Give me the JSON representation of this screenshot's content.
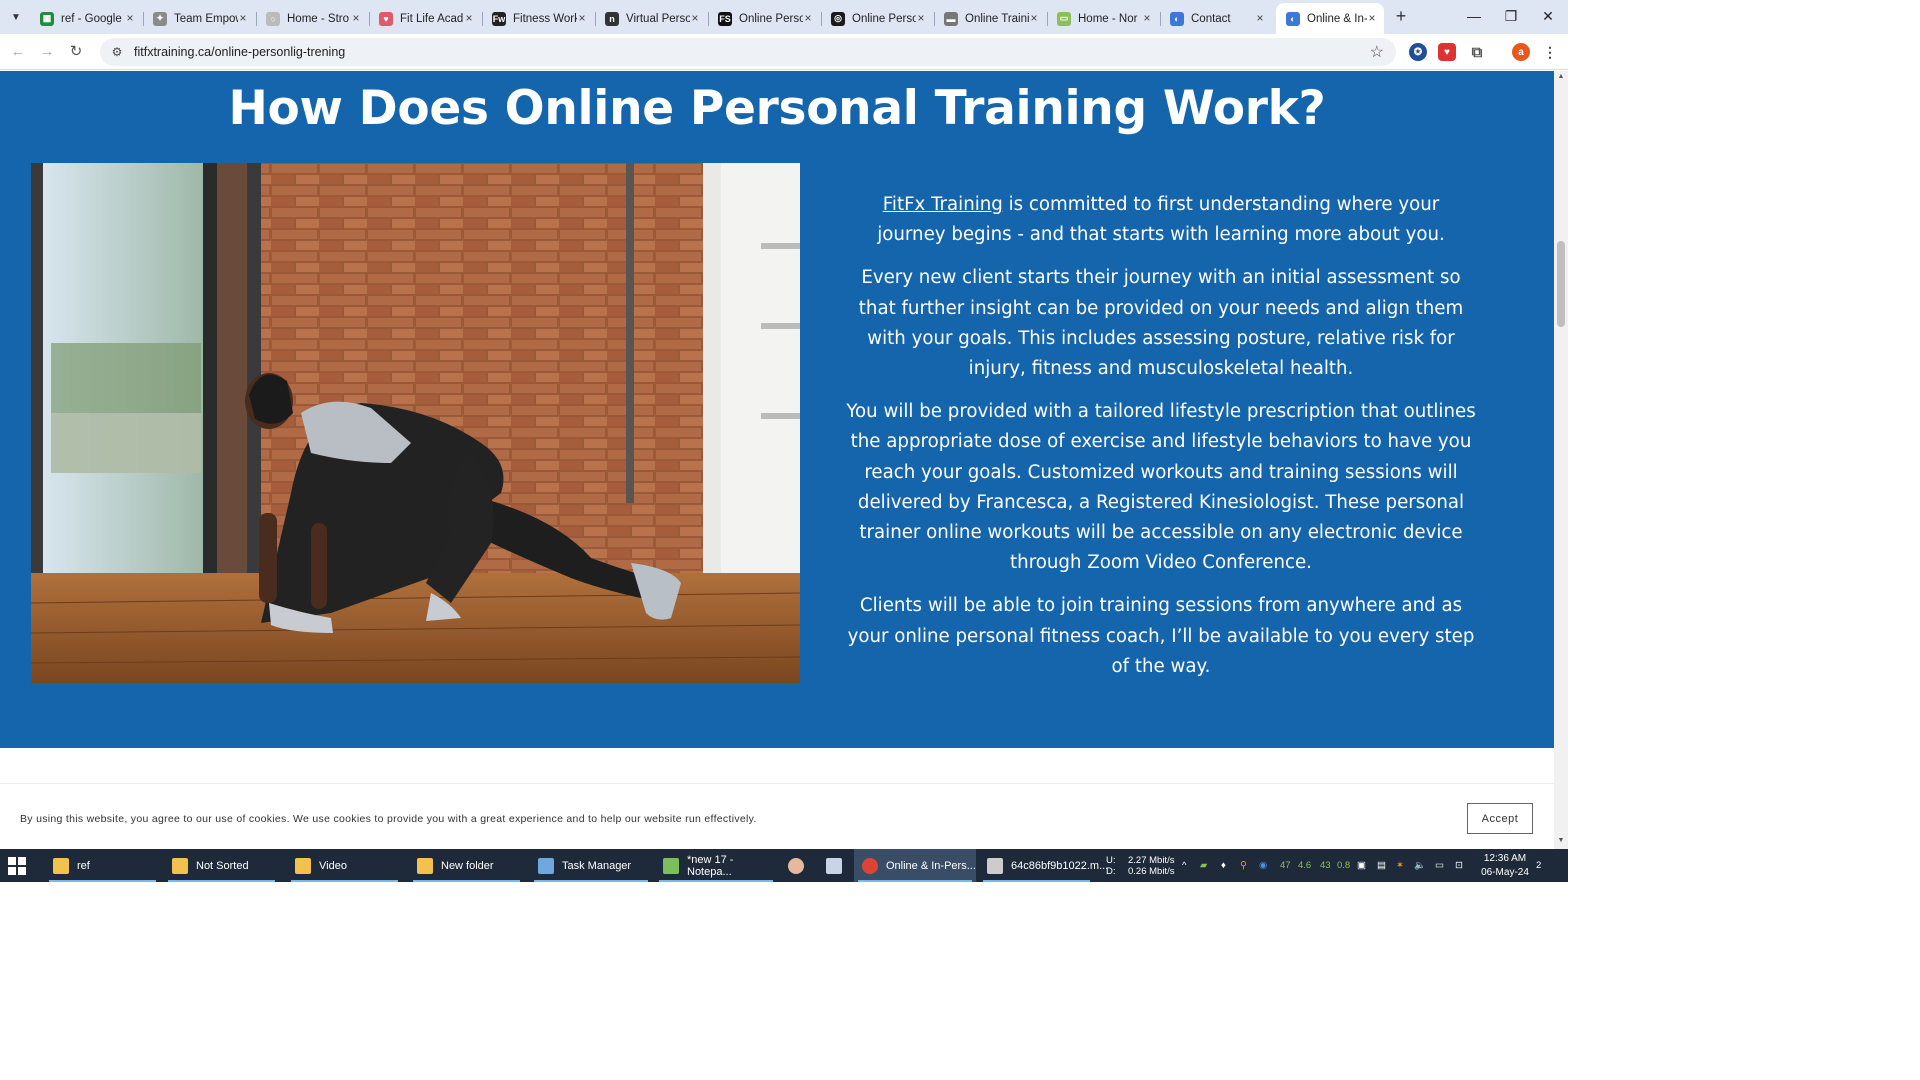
{
  "browser": {
    "tabs": [
      {
        "title": "ref - Google",
        "favicon_color": "#1e8e3e",
        "favicon_glyph": "▦"
      },
      {
        "title": "Team Empow",
        "favicon_color": "#8a8a8a",
        "favicon_glyph": "✦"
      },
      {
        "title": "Home - Stro",
        "favicon_color": "#bbbbbb",
        "favicon_glyph": "○"
      },
      {
        "title": "Fit Life Acad",
        "favicon_color": "#e05a6a",
        "favicon_glyph": "♥"
      },
      {
        "title": "Fitness Work",
        "favicon_color": "#222222",
        "favicon_glyph": "Fw"
      },
      {
        "title": "Virtual Perso",
        "favicon_color": "#333333",
        "favicon_glyph": "n"
      },
      {
        "title": "Online Perso",
        "favicon_color": "#111111",
        "favicon_glyph": "FS"
      },
      {
        "title": "Online Perso",
        "favicon_color": "#1a1a1a",
        "favicon_glyph": "◎"
      },
      {
        "title": "Online Traini",
        "favicon_color": "#777777",
        "favicon_glyph": "▬"
      },
      {
        "title": "Home - Nor",
        "favicon_color": "#8bbf5a",
        "favicon_glyph": "▭"
      },
      {
        "title": "Contact",
        "favicon_color": "#3c78d8",
        "favicon_glyph": "◐"
      },
      {
        "title": "Online & In-",
        "favicon_color": "#3c78d8",
        "favicon_glyph": "◐"
      }
    ],
    "url": "fitfxtraining.ca/online-personlig-trening",
    "profile_initial": "a"
  },
  "page": {
    "heading": "How Does Online Personal Training Work?",
    "p1_link": "FitFx Training",
    "p1_rest": " is committed to first understanding where your journey begins - and that starts with learning more about you.",
    "p2": "Every new client starts their journey with an initial assessment so that further insight can be provided on your needs and align them with your goals. This includes assessing posture, relative risk for injury, fitness and musculoskeletal health.",
    "p3": "You will be provided with a tailored lifestyle prescription that outlines the appropriate dose of exercise and lifestyle behaviors to have you reach your goals. Customized workouts and training sessions will delivered by Francesca, a Registered Kinesiologist. These personal trainer online workouts will be accessible on any electronic device through Zoom Video Conference.",
    "p4": "Clients will be able to join training sessions from anywhere and as your online personal fitness coach, I’ll be available to you every step of the way."
  },
  "cookie": {
    "text": "By using this website, you agree to our use of cookies. We use cookies to provide you with a great experience and to help our website run effectively.",
    "accept": "Accept"
  },
  "taskbar": {
    "items": [
      {
        "label": "ref",
        "icon_color": "#f2c14e"
      },
      {
        "label": "Not Sorted",
        "icon_color": "#f2c14e"
      },
      {
        "label": "Video",
        "icon_color": "#f2c14e"
      },
      {
        "label": "New folder",
        "icon_color": "#f2c14e"
      },
      {
        "label": "Task Manager",
        "icon_color": "#6fa8dc"
      },
      {
        "label": "*new 17 - Notepa...",
        "icon_color": "#7cbf5a"
      },
      {
        "label": "Online & In-Pers...",
        "icon_color": "#db4437"
      },
      {
        "label": "64c86bf9b1022.m...",
        "icon_color": "#cccccc"
      }
    ],
    "net_up_label": "U:",
    "net_up": "2.27 Mbit/s",
    "net_down_label": "D:",
    "net_down": "0.26 Mbit/s",
    "tray_nums": [
      "47",
      "4.6",
      "43",
      "0.8"
    ],
    "time": "12:36 AM",
    "date": "06-May-24",
    "notifications": "2"
  }
}
